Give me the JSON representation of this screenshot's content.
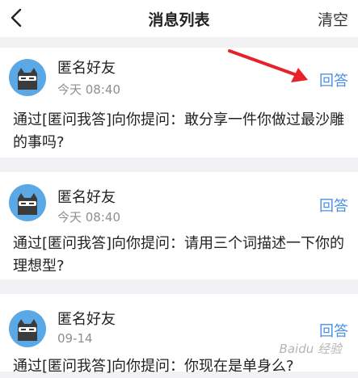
{
  "header": {
    "title": "消息列表",
    "clear_label": "清空",
    "back_icon": "back-chevron-icon"
  },
  "messages": [
    {
      "sender": "匿名好友",
      "time": "今天 08:40",
      "reply_label": "回答",
      "question": "通过[匿问我答]向你提问：敢分享一件你做过最沙雕的事吗?"
    },
    {
      "sender": "匿名好友",
      "time": "今天 08:40",
      "reply_label": "回答",
      "question": "通过[匿问我答]向你提问：请用三个词描述一下你的理想型?"
    },
    {
      "sender": "匿名好友",
      "time": "09-14",
      "reply_label": "回答",
      "question": "通过[匿问我答]向你提问：你现在是单身么?"
    }
  ],
  "colors": {
    "accent": "#4a90e2",
    "annotation_arrow": "#e8202a",
    "avatar_bg": "#5aa9e6"
  },
  "watermark": "Baidu 经验"
}
